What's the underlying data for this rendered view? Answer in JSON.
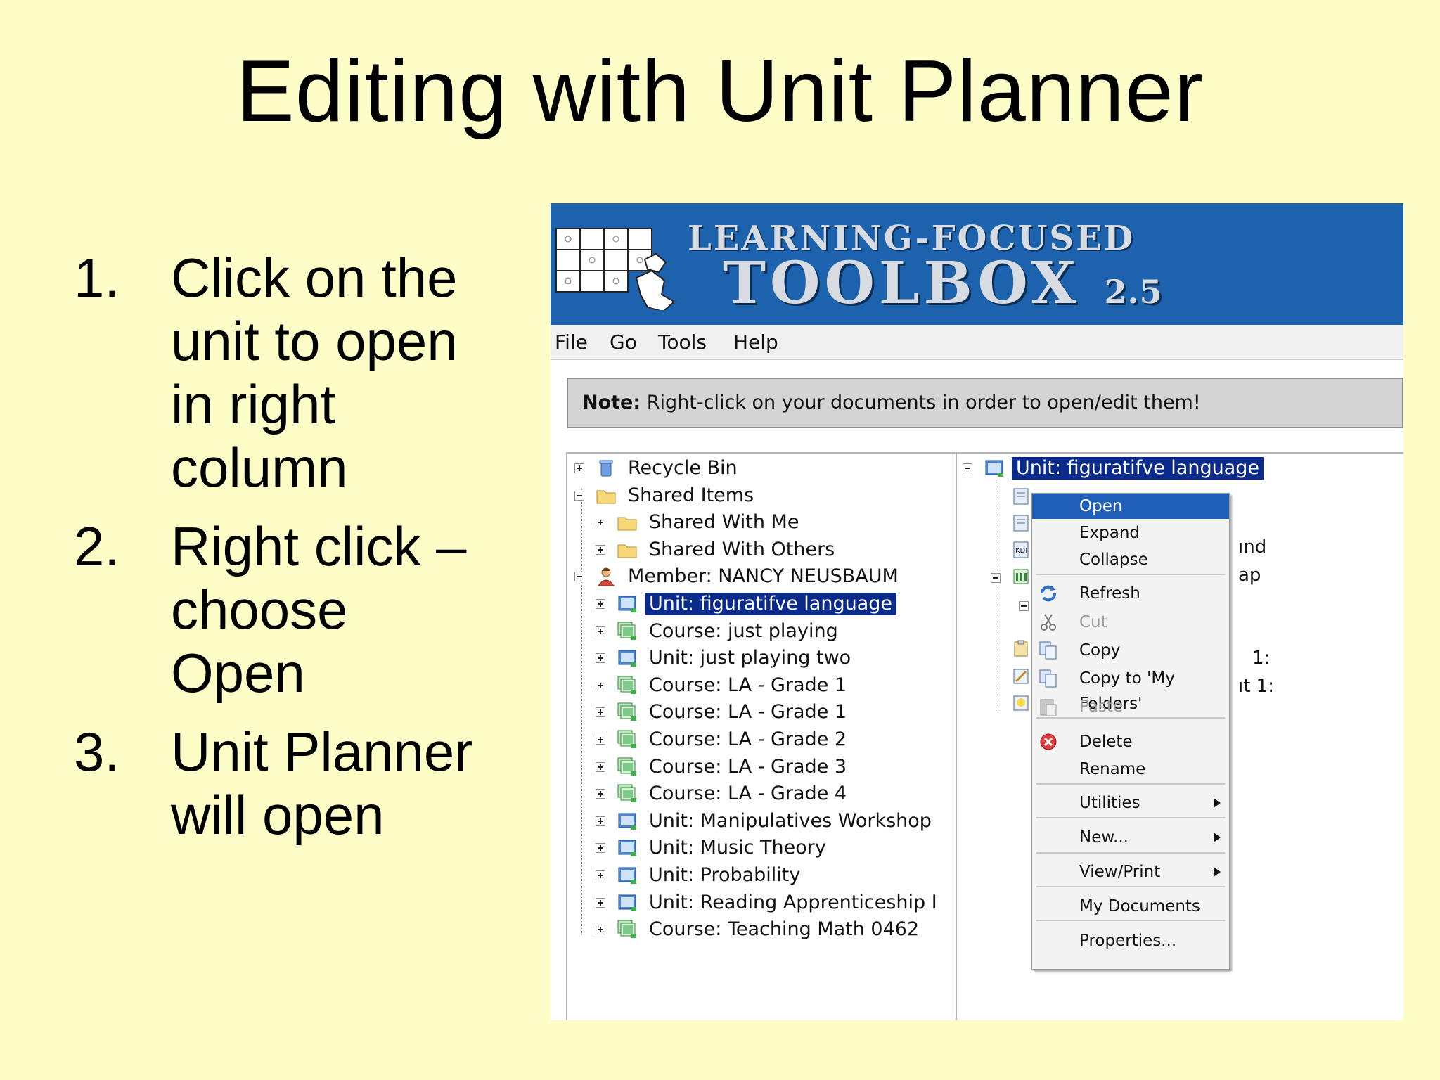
{
  "slide": {
    "title": "Editing with Unit Planner",
    "steps": [
      {
        "num": "1.",
        "lines": [
          "Click on the",
          "unit to open",
          "in right",
          "column"
        ]
      },
      {
        "num": "2.",
        "lines": [
          "Right click –",
          "choose",
          "Open"
        ]
      },
      {
        "num": "3.",
        "lines": [
          "Unit Planner",
          "will open"
        ]
      }
    ]
  },
  "app": {
    "brand_line1": "LEARNING-FOCUSED",
    "brand_line2": "TOOLBOX",
    "brand_version": "2.5",
    "menu": [
      "File",
      "Go",
      "Tools",
      "Help"
    ],
    "note_bold": "Note:",
    "note_text": " Right-click on your documents in order to open/edit them!",
    "left_tree": [
      {
        "label": "Recycle Bin",
        "icon": "recycle-bin-icon",
        "expander": "plus"
      },
      {
        "label": "Shared Items",
        "icon": "folder-icon",
        "expander": "minus"
      },
      {
        "label": "Shared With Me",
        "icon": "folder-icon",
        "expander": "plus"
      },
      {
        "label": "Shared With Others",
        "icon": "folder-icon",
        "expander": "plus"
      },
      {
        "label": "Member: NANCY NEUSBAUM",
        "icon": "user-icon",
        "expander": "minus"
      },
      {
        "label": "Unit: figuratifve language",
        "icon": "unit-icon",
        "expander": "plus",
        "selected": true
      },
      {
        "label": "Course: just playing",
        "icon": "course-icon",
        "expander": "plus"
      },
      {
        "label": "Unit: just playing two",
        "icon": "unit-icon",
        "expander": "plus"
      },
      {
        "label": "Course: LA - Grade 1",
        "icon": "course-icon",
        "expander": "plus"
      },
      {
        "label": "Course: LA - Grade 1",
        "icon": "course-icon",
        "expander": "plus"
      },
      {
        "label": "Course: LA - Grade 2",
        "icon": "course-icon",
        "expander": "plus"
      },
      {
        "label": "Course: LA - Grade 3",
        "icon": "course-icon",
        "expander": "plus"
      },
      {
        "label": "Course: LA - Grade 4",
        "icon": "course-icon",
        "expander": "plus"
      },
      {
        "label": "Unit: Manipulatives Workshop",
        "icon": "unit-icon",
        "expander": "plus"
      },
      {
        "label": "Unit: Music Theory",
        "icon": "unit-icon",
        "expander": "plus"
      },
      {
        "label": "Unit: Probability",
        "icon": "unit-icon",
        "expander": "plus"
      },
      {
        "label": "Unit: Reading Apprenticeship I",
        "icon": "unit-icon",
        "expander": "plus"
      },
      {
        "label": "Course: Teaching Math 0462",
        "icon": "course-icon",
        "expander": "plus"
      }
    ],
    "right_root": "Unit: figuratifve language",
    "right_fragments": [
      "ınd",
      "ap",
      "1:",
      "ıt 1:"
    ],
    "context_menu": [
      {
        "label": "Open",
        "icon": "",
        "highlighted": true
      },
      {
        "label": "Expand",
        "icon": ""
      },
      {
        "label": "Collapse",
        "icon": ""
      },
      {
        "label": "Refresh",
        "icon": "refresh-icon"
      },
      {
        "label": "Cut",
        "icon": "scissors-icon",
        "disabled": true
      },
      {
        "label": "Copy",
        "icon": "copy-icon"
      },
      {
        "label": "Copy to 'My Folders'",
        "icon": "copy-icon"
      },
      {
        "label": "Paste",
        "icon": "paste-icon",
        "disabled": true
      },
      {
        "label": "Delete",
        "icon": "delete-icon"
      },
      {
        "label": "Rename",
        "icon": ""
      },
      {
        "label": "Utilities",
        "icon": "",
        "submenu": true
      },
      {
        "label": "New...",
        "icon": "",
        "submenu": true
      },
      {
        "label": "View/Print",
        "icon": "",
        "submenu": true
      },
      {
        "label": "My Documents",
        "icon": ""
      },
      {
        "label": "Properties...",
        "icon": ""
      }
    ]
  }
}
